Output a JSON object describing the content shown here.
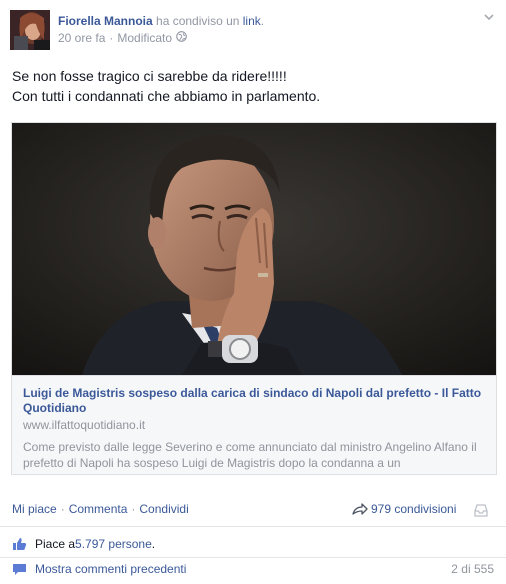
{
  "post": {
    "author": "Fiorella Mannoia",
    "shared_prefix": "ha condiviso un",
    "shared_link": "link",
    "shared_suffix": ".",
    "time": "20 ore fa",
    "dot": "·",
    "edited": "Modificato",
    "message_line1": "Se non fosse tragico ci sarebbe da ridere!!!!!",
    "message_line2": "Con tutti i condannati che abbiamo in parlamento."
  },
  "preview": {
    "title": "Luigi de Magistris sospeso dalla carica di sindaco di Napoli dal prefetto - Il Fatto Quotidiano",
    "domain": "www.ilfattoquotidiano.it",
    "description": "Come previsto dalle legge Severino e come annunciato dal ministro Angelino Alfano il prefetto di Napoli ha sospeso Luigi de Magistris dopo la condanna a un"
  },
  "actions": {
    "like": "Mi piace",
    "comment": "Commenta",
    "share": "Condividi",
    "separator": "·",
    "shares_count": "979 condivisioni"
  },
  "likes": {
    "prefix": "Piace a ",
    "count": "5.797 persone",
    "suffix": "."
  },
  "comments": {
    "more": "Mostra commenti precedenti",
    "pager": "2 di 555"
  },
  "icons": {
    "globe": "globe-icon",
    "caret": "chevron-down-icon",
    "share": "share-arrow-icon",
    "inbox": "inbox-icon",
    "thumbs_up": "thumbs-up-icon",
    "comment": "comment-bubble-icon"
  },
  "colors": {
    "link": "#3b5998",
    "meta": "#9197a3",
    "text": "#141823",
    "preview_bg": "#f6f7f9"
  }
}
